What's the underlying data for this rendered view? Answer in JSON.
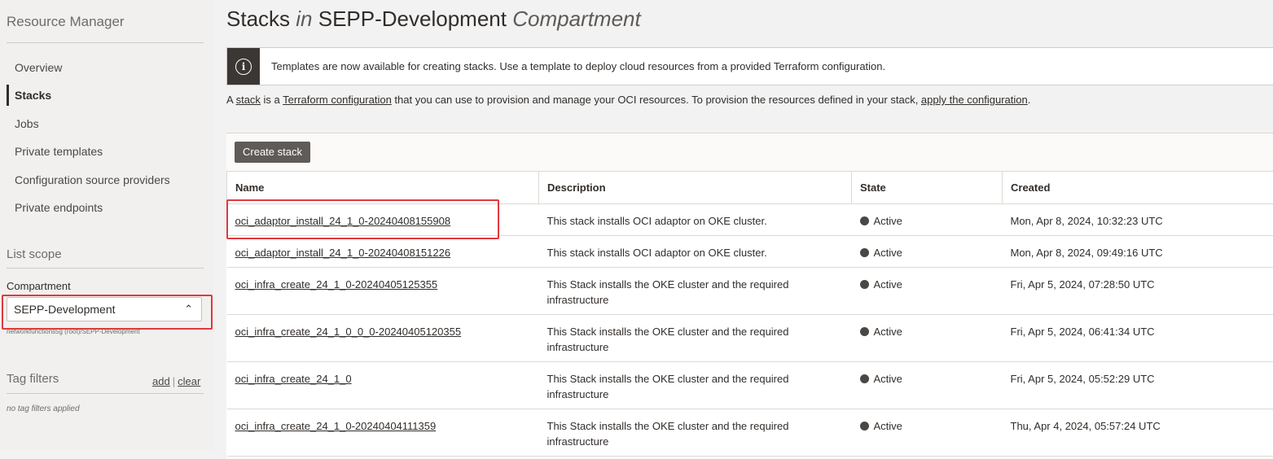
{
  "sidebar": {
    "title": "Resource Manager",
    "nav": [
      {
        "label": "Overview",
        "active": false
      },
      {
        "label": "Stacks",
        "active": true
      },
      {
        "label": "Jobs",
        "active": false
      },
      {
        "label": "Private templates",
        "active": false
      },
      {
        "label": "Configuration source providers",
        "active": false
      },
      {
        "label": "Private endpoints",
        "active": false
      }
    ],
    "list_scope_heading": "List scope",
    "compartment_label": "Compartment",
    "compartment_value": "SEPP-Development",
    "compartment_path": "networkfunctions5g (root)/SEPP-Development",
    "tag_filters_heading": "Tag filters",
    "tag_add": "add",
    "tag_sep": "|",
    "tag_clear": "clear",
    "no_tag_filters": "no tag filters applied"
  },
  "header": {
    "title_prefix": "Stacks",
    "title_in": "in",
    "title_compartment": "SEPP-Development",
    "title_suffix": "Compartment"
  },
  "banner": {
    "icon": "info-icon",
    "text": "Templates are now available for creating stacks. Use a template to deploy cloud resources from a provided Terraform configuration."
  },
  "intro": {
    "t1": "A ",
    "link_stack": "stack",
    "t2": " is a ",
    "link_terraform": "Terraform configuration",
    "t3": " that you can use to provision and manage your OCI resources. To provision the resources defined in your stack, ",
    "link_apply": "apply the configuration",
    "t4": "."
  },
  "toolbar": {
    "create_label": "Create stack"
  },
  "table": {
    "columns": [
      "Name",
      "Description",
      "State",
      "Created"
    ],
    "rows": [
      {
        "name": "oci_adaptor_install_24_1_0-20240408155908",
        "description": "This stack installs OCI adaptor on OKE cluster.",
        "state": "Active",
        "created": "Mon, Apr 8, 2024, 10:32:23 UTC"
      },
      {
        "name": "oci_adaptor_install_24_1_0-20240408151226",
        "description": "This stack installs OCI adaptor on OKE cluster.",
        "state": "Active",
        "created": "Mon, Apr 8, 2024, 09:49:16 UTC"
      },
      {
        "name": "oci_infra_create_24_1_0-20240405125355",
        "description": "This Stack installs the OKE cluster and the required infrastructure",
        "state": "Active",
        "created": "Fri, Apr 5, 2024, 07:28:50 UTC"
      },
      {
        "name": "oci_infra_create_24_1_0_0_0-20240405120355",
        "description": "This Stack installs the OKE cluster and the required infrastructure",
        "state": "Active",
        "created": "Fri, Apr 5, 2024, 06:41:34 UTC"
      },
      {
        "name": "oci_infra_create_24_1_0",
        "description": "This Stack installs the OKE cluster and the required infrastructure",
        "state": "Active",
        "created": "Fri, Apr 5, 2024, 05:52:29 UTC"
      },
      {
        "name": "oci_infra_create_24_1_0-20240404111359",
        "description": "This Stack installs the OKE cluster and the required infrastructure",
        "state": "Active",
        "created": "Thu, Apr 4, 2024, 05:57:24 UTC"
      }
    ]
  },
  "colors": {
    "highlight": "#e0393e",
    "button_bg": "#5e5b58",
    "banner_icon_bg": "#3b3734"
  }
}
